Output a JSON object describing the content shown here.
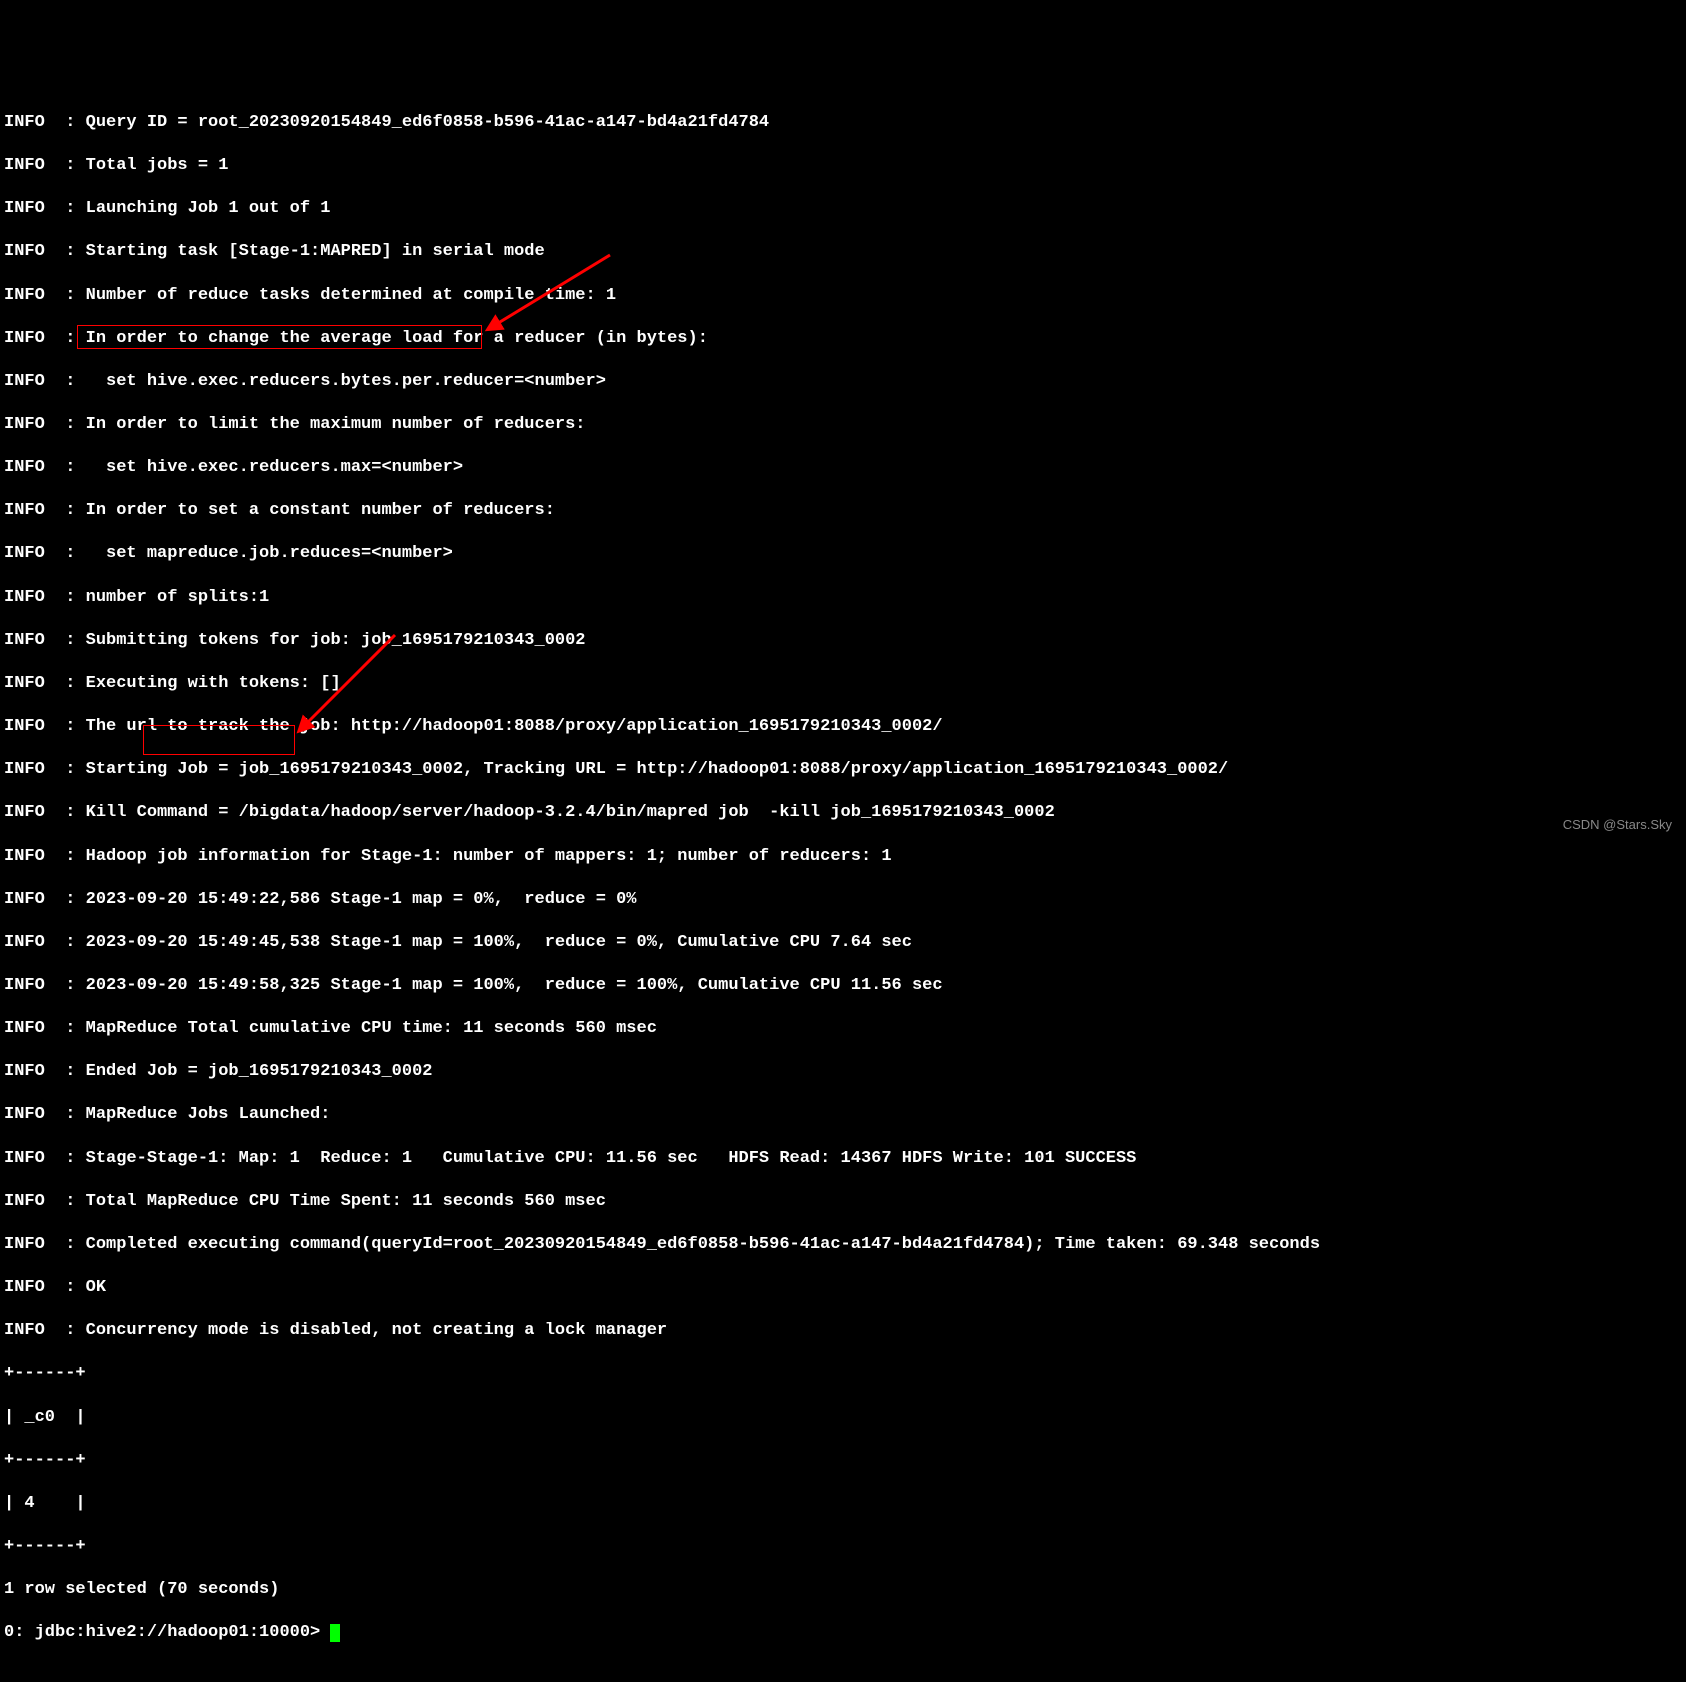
{
  "lines": [
    "INFO  : Query ID = root_20230920154849_ed6f0858-b596-41ac-a147-bd4a21fd4784",
    "INFO  : Total jobs = 1",
    "INFO  : Launching Job 1 out of 1",
    "INFO  : Starting task [Stage-1:MAPRED] in serial mode",
    "INFO  : Number of reduce tasks determined at compile time: 1",
    "INFO  : In order to change the average load for a reducer (in bytes):",
    "INFO  :   set hive.exec.reducers.bytes.per.reducer=<number>",
    "INFO  : In order to limit the maximum number of reducers:",
    "INFO  :   set hive.exec.reducers.max=<number>",
    "INFO  : In order to set a constant number of reducers:",
    "INFO  :   set mapreduce.job.reduces=<number>",
    "INFO  : number of splits:1",
    "INFO  : Submitting tokens for job: job_1695179210343_0002",
    "INFO  : Executing with tokens: []",
    "INFO  : The url to track the job: http://hadoop01:8088/proxy/application_1695179210343_0002/",
    "INFO  : Starting Job = job_1695179210343_0002, Tracking URL = http://hadoop01:8088/proxy/application_1695179210343_0002/",
    "INFO  : Kill Command = /bigdata/hadoop/server/hadoop-3.2.4/bin/mapred job  -kill job_1695179210343_0002",
    "INFO  : Hadoop job information for Stage-1: number of mappers: 1; number of reducers: 1",
    "INFO  : 2023-09-20 15:49:22,586 Stage-1 map = 0%,  reduce = 0%",
    "INFO  : 2023-09-20 15:49:45,538 Stage-1 map = 100%,  reduce = 0%, Cumulative CPU 7.64 sec",
    "INFO  : 2023-09-20 15:49:58,325 Stage-1 map = 100%,  reduce = 100%, Cumulative CPU 11.56 sec",
    "INFO  : MapReduce Total cumulative CPU time: 11 seconds 560 msec",
    "INFO  : Ended Job = job_1695179210343_0002",
    "INFO  : MapReduce Jobs Launched:",
    "INFO  : Stage-Stage-1: Map: 1  Reduce: 1   Cumulative CPU: 11.56 sec   HDFS Read: 14367 HDFS Write: 101 SUCCESS",
    "INFO  : Total MapReduce CPU Time Spent: 11 seconds 560 msec",
    "INFO  : Completed executing command(queryId=root_20230920154849_ed6f0858-b596-41ac-a147-bd4a21fd4784); Time taken: 69.348 seconds",
    "INFO  : OK",
    "INFO  : Concurrency mode is disabled, not creating a lock manager",
    "+------+",
    "| _c0  |",
    "+------+",
    "| 4    |",
    "+------+",
    "1 row selected (70 seconds)"
  ],
  "prompt": "0: jdbc:hive2://hadoop01:10000> ",
  "watermark": "CSDN @Stars.Sky"
}
